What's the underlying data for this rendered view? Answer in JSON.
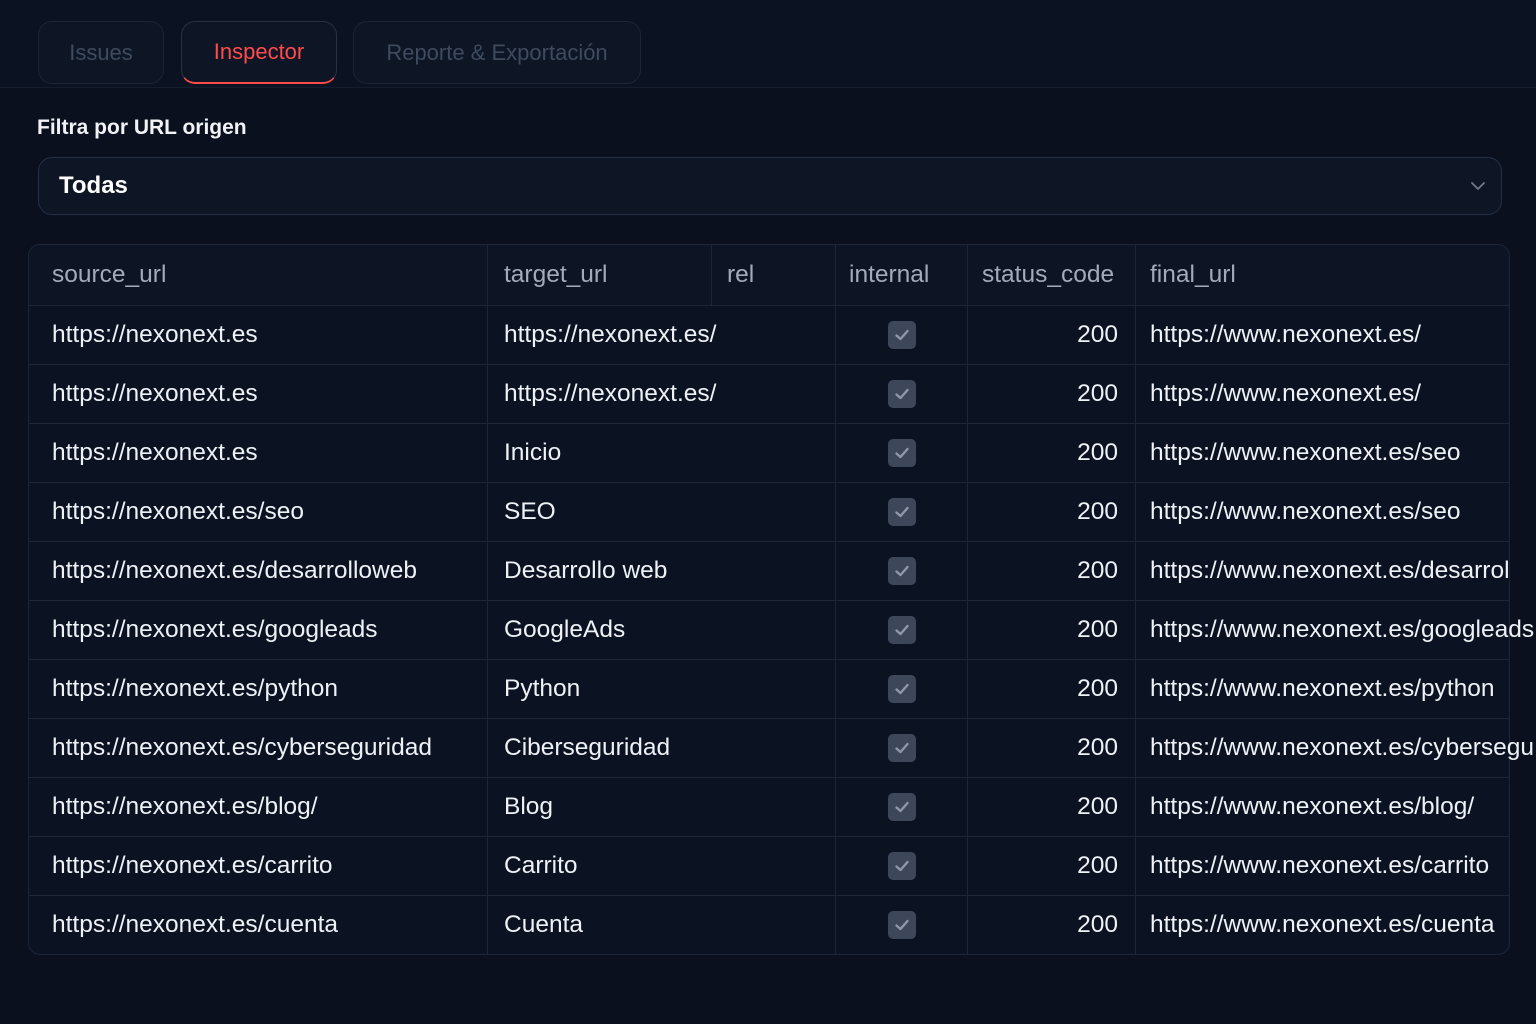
{
  "tabs": [
    {
      "label": "Issues",
      "active": false
    },
    {
      "label": "Inspector",
      "active": true
    },
    {
      "label": "Reporte & Exportación",
      "active": false
    }
  ],
  "filter": {
    "label": "Filtra por URL origen",
    "selected": "Todas",
    "icon": "chevron-down-icon"
  },
  "table": {
    "columns": [
      "source_url",
      "target_url",
      "rel",
      "internal",
      "status_code",
      "final_url"
    ],
    "checkbox_icon": "check-icon",
    "rows": [
      {
        "source_url": "https://nexonext.es",
        "target_url": "https://nexonext.es/",
        "internal": true,
        "status_code": 200,
        "final_url": "https://www.nexonext.es/"
      },
      {
        "source_url": "https://nexonext.es",
        "target_url": "https://nexonext.es/",
        "internal": true,
        "status_code": 200,
        "final_url": "https://www.nexonext.es/"
      },
      {
        "source_url": "https://nexonext.es",
        "target_url": "Inicio",
        "internal": true,
        "status_code": 200,
        "final_url": "https://www.nexonext.es/seo"
      },
      {
        "source_url": "https://nexonext.es/seo",
        "target_url": "SEO",
        "internal": true,
        "status_code": 200,
        "final_url": "https://www.nexonext.es/seo"
      },
      {
        "source_url": "https://nexonext.es/desarrolloweb",
        "target_url": "Desarrollo web",
        "internal": true,
        "status_code": 200,
        "final_url": "https://www.nexonext.es/desarrol"
      },
      {
        "source_url": "https://nexonext.es/googleads",
        "target_url": "GoogleAds",
        "internal": true,
        "status_code": 200,
        "final_url": "https://www.nexonext.es/googleads"
      },
      {
        "source_url": "https://nexonext.es/python",
        "target_url": "Python",
        "internal": true,
        "status_code": 200,
        "final_url": "https://www.nexonext.es/python"
      },
      {
        "source_url": "https://nexonext.es/cyberseguridad",
        "target_url": "Ciberseguridad",
        "internal": true,
        "status_code": 200,
        "final_url": "https://www.nexonext.es/cybersegu"
      },
      {
        "source_url": "https://nexonext.es/blog/",
        "target_url": "Blog",
        "internal": true,
        "status_code": 200,
        "final_url": "https://www.nexonext.es/blog/"
      },
      {
        "source_url": "https://nexonext.es/carrito",
        "target_url": "Carrito",
        "internal": true,
        "status_code": 200,
        "final_url": "https://www.nexonext.es/carrito"
      },
      {
        "source_url": "https://nexonext.es/cuenta",
        "target_url": "Cuenta",
        "internal": true,
        "status_code": 200,
        "final_url": "https://www.nexonext.es/cuenta"
      }
    ]
  },
  "colors": {
    "background": "#0a101e",
    "accent": "#ff4b4b",
    "text": "#eef1f6",
    "muted_text": "#a3abba",
    "border": "#1c2638",
    "checkbox_fill": "#3d4759",
    "checkbox_mark": "#8e98a8"
  }
}
